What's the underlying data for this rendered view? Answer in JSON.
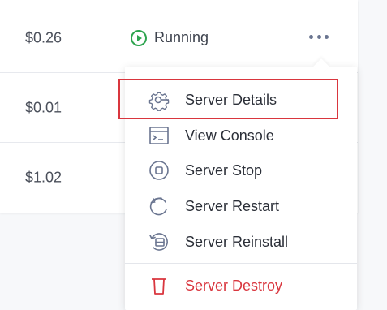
{
  "rows": [
    {
      "price": "$0.26",
      "status": "Running"
    },
    {
      "price": "$0.01"
    },
    {
      "price": "$1.02"
    }
  ],
  "menu": {
    "items": [
      {
        "label": "Server Details",
        "icon": "gear-icon"
      },
      {
        "label": "View Console",
        "icon": "console-icon"
      },
      {
        "label": "Server Stop",
        "icon": "stop-icon"
      },
      {
        "label": "Server Restart",
        "icon": "restart-icon"
      },
      {
        "label": "Server Reinstall",
        "icon": "reinstall-icon"
      },
      {
        "label": "Server Destroy",
        "icon": "trash-icon"
      }
    ],
    "highlighted_index": 0
  },
  "colors": {
    "running": "#2ea44f",
    "danger": "#d9363e",
    "icon": "#6a7590"
  }
}
